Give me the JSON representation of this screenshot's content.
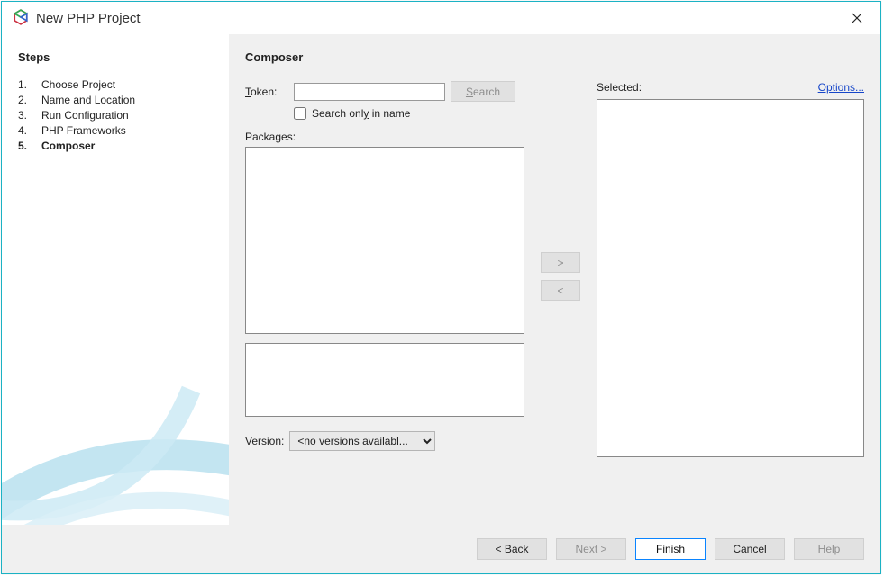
{
  "window": {
    "title": "New PHP Project"
  },
  "sidebar": {
    "heading": "Steps",
    "steps": [
      {
        "num": "1.",
        "label": "Choose Project"
      },
      {
        "num": "2.",
        "label": "Name and Location"
      },
      {
        "num": "3.",
        "label": "Run Configuration"
      },
      {
        "num": "4.",
        "label": "PHP Frameworks"
      },
      {
        "num": "5.",
        "label": "Composer"
      }
    ],
    "current_index": 4
  },
  "main": {
    "heading": "Composer",
    "token_label_pre": "T",
    "token_label_post": "oken:",
    "token_value": "",
    "search_label_pre": "S",
    "search_label_post": "earch",
    "checkbox_label_pre": "Search onl",
    "checkbox_label_u": "y",
    "checkbox_label_post": " in name",
    "checkbox_checked": false,
    "packages_label": "Packages:",
    "version_label_pre": "V",
    "version_label_post": "ersion:",
    "version_selected": "<no versions availabl...",
    "selected_label": "Selected:",
    "options_label": "Options...",
    "move_right": ">",
    "move_left": "<"
  },
  "footer": {
    "back_pre": "< ",
    "back_u": "B",
    "back_post": "ack",
    "next": "Next >",
    "finish_u": "F",
    "finish_post": "inish",
    "cancel": "Cancel",
    "help_u": "H",
    "help_post": "elp"
  }
}
